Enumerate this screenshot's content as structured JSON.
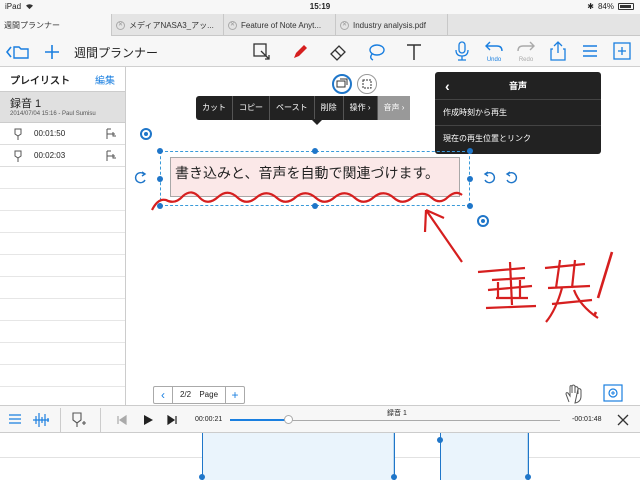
{
  "statusbar": {
    "device": "iPad",
    "time": "15:19",
    "battery": "84%",
    "battery_level": 0.84
  },
  "tabs": [
    {
      "label": "週間プランナー"
    },
    {
      "label": "メディアNASA3_アッ..."
    },
    {
      "label": "Feature of Note Anyt..."
    },
    {
      "label": "Industry analysis.pdf"
    }
  ],
  "toolbar": {
    "title": "週間プランナー",
    "undo_label": "Undo",
    "redo_label": "Redo"
  },
  "sidebar": {
    "heading": "プレイリスト",
    "edit_label": "編集",
    "recording": {
      "title": "録音 1",
      "meta": "2014/07/04 15:16 - Paul Sumisu"
    },
    "marks": [
      {
        "time": "00:01:50"
      },
      {
        "time": "00:02:03"
      }
    ]
  },
  "context_menu": {
    "items": [
      "カット",
      "コピー",
      "ペースト",
      "削除",
      "操作",
      "音声"
    ]
  },
  "audio_popup": {
    "title": "音声",
    "options": [
      "作成時刻から再生",
      "現在の再生位置とリンク"
    ]
  },
  "note": {
    "text": "書き込みと、音声を自動で関連づけます。",
    "handwriting": "重要！"
  },
  "page_nav": {
    "page": "2/2",
    "label": "Page"
  },
  "player": {
    "title": "録音 1",
    "elapsed": "00:00:21",
    "remaining": "-00:01:48",
    "progress": 0.16
  },
  "colors": {
    "accent": "#1a7fe0",
    "ink_red": "#d61f1f",
    "selection": "#1f76c9"
  }
}
